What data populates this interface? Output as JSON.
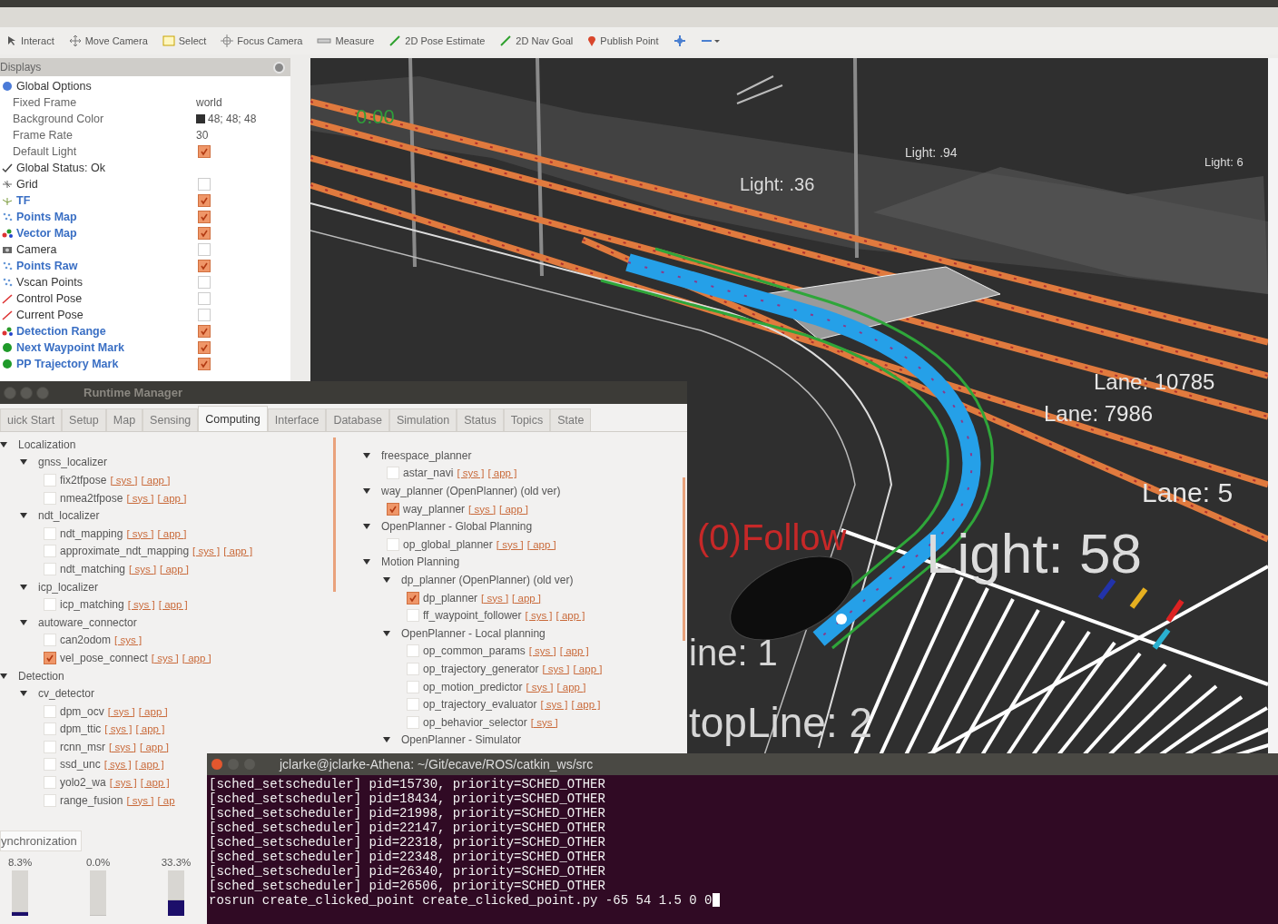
{
  "toolbar": {
    "tools": [
      {
        "label": "Interact",
        "kind": "interact"
      },
      {
        "label": "Move Camera",
        "kind": "move"
      },
      {
        "label": "Select",
        "kind": "select"
      },
      {
        "label": "Focus Camera",
        "kind": "focus"
      },
      {
        "label": "Measure",
        "kind": "measure"
      },
      {
        "label": "2D Pose Estimate",
        "kind": "pose"
      },
      {
        "label": "2D Nav Goal",
        "kind": "pose"
      },
      {
        "label": "Publish Point",
        "kind": "pin"
      },
      {
        "kind": "cross"
      },
      {
        "kind": "minus"
      }
    ]
  },
  "displays": {
    "title": "Displays",
    "items": [
      {
        "label": "Global Options",
        "kind": "globe",
        "highlighted": false,
        "children": [
          {
            "label": "Fixed Frame",
            "value": "world"
          },
          {
            "label": "Background Color",
            "value": "48; 48; 48",
            "kind": "swatch"
          },
          {
            "label": "Frame Rate",
            "value": "30"
          },
          {
            "label": "Default Light",
            "checked": true
          }
        ]
      },
      {
        "label": "Global Status: Ok",
        "kind": "status",
        "highlighted": false
      },
      {
        "label": "Grid",
        "kind": "grid",
        "checked": false,
        "highlighted": false
      },
      {
        "label": "TF",
        "kind": "tf",
        "checked": true,
        "highlighted": true
      },
      {
        "label": "Points Map",
        "kind": "points",
        "checked": true,
        "highlighted": true
      },
      {
        "label": "Vector Map",
        "kind": "markers",
        "checked": true,
        "highlighted": true
      },
      {
        "label": "Camera",
        "kind": "camera",
        "checked": false,
        "highlighted": false
      },
      {
        "label": "Points Raw",
        "kind": "points",
        "checked": true,
        "highlighted": true
      },
      {
        "label": "Vscan Points",
        "kind": "points",
        "checked": false,
        "highlighted": false
      },
      {
        "label": "Control Pose",
        "kind": "pose",
        "checked": false,
        "highlighted": false
      },
      {
        "label": "Current Pose",
        "kind": "pose",
        "checked": false,
        "highlighted": false
      },
      {
        "label": "Detection Range",
        "kind": "markers",
        "checked": true,
        "highlighted": true
      },
      {
        "label": "Next Waypoint Mark",
        "kind": "sphere",
        "checked": true,
        "highlighted": true
      },
      {
        "label": "PP Trajectory Mark",
        "kind": "sphere",
        "checked": true,
        "highlighted": true
      }
    ]
  },
  "scene": {
    "labels": [
      {
        "text": "0.00",
        "kind": "speed"
      },
      {
        "text": "Light: .36",
        "kind": "light"
      },
      {
        "text": "Light: .94",
        "kind": "light"
      },
      {
        "text": "Light: 6",
        "kind": "light"
      },
      {
        "text": "Lane: 10785",
        "kind": "lane"
      },
      {
        "text": "Lane: 7986",
        "kind": "lane"
      },
      {
        "text": "Lane: 5",
        "kind": "lane"
      },
      {
        "text": "(0)Follow",
        "kind": "behavior"
      },
      {
        "text": "Light:  58",
        "kind": "light"
      },
      {
        "text": "ine:  1",
        "kind": "line"
      },
      {
        "text": "topLine:  2",
        "kind": "line"
      }
    ]
  },
  "runtime_manager": {
    "title": "Runtime Manager",
    "tabs": [
      {
        "label": "uick Start",
        "selected": false
      },
      {
        "label": "Setup",
        "selected": false
      },
      {
        "label": "Map",
        "selected": false
      },
      {
        "label": "Sensing",
        "selected": false
      },
      {
        "label": "Computing",
        "selected": true
      },
      {
        "label": "Interface",
        "selected": false
      },
      {
        "label": "Database",
        "selected": false
      },
      {
        "label": "Simulation",
        "selected": false
      },
      {
        "label": "Status",
        "selected": false
      },
      {
        "label": "Topics",
        "selected": false
      },
      {
        "label": "State",
        "selected": false
      }
    ],
    "left_tree": [
      {
        "label": "Localization",
        "expanded": true,
        "children": [
          {
            "label": "gnss_localizer",
            "expanded": true,
            "children": [
              {
                "label": "fix2tfpose",
                "checked": false,
                "links": [
                  "[ sys ]",
                  "[ app ]"
                ]
              },
              {
                "label": "nmea2tfpose",
                "checked": false,
                "links": [
                  "[ sys ]",
                  "[ app ]"
                ]
              }
            ]
          },
          {
            "label": "ndt_localizer",
            "expanded": true,
            "children": [
              {
                "label": "ndt_mapping",
                "checked": false,
                "links": [
                  "[ sys ]",
                  "[ app ]"
                ]
              },
              {
                "label": "approximate_ndt_mapping",
                "checked": false,
                "links": [
                  "[ sys ]",
                  "[ app ]"
                ]
              },
              {
                "label": "ndt_matching",
                "checked": false,
                "links": [
                  "[ sys ]",
                  "[ app ]"
                ]
              }
            ]
          },
          {
            "label": "icp_localizer",
            "expanded": true,
            "children": [
              {
                "label": "icp_matching",
                "checked": false,
                "links": [
                  "[ sys ]",
                  "[ app ]"
                ]
              }
            ]
          },
          {
            "label": "autoware_connector",
            "expanded": true,
            "children": [
              {
                "label": "can2odom",
                "checked": false,
                "links": [
                  "[ sys ]"
                ]
              },
              {
                "label": "vel_pose_connect",
                "checked": true,
                "links": [
                  "[ sys ]",
                  "[ app ]"
                ]
              }
            ]
          }
        ]
      },
      {
        "label": "Detection",
        "expanded": true,
        "children": [
          {
            "label": "cv_detector",
            "expanded": true,
            "children": [
              {
                "label": "dpm_ocv",
                "checked": false,
                "links": [
                  "[ sys ]",
                  "[ app ]"
                ]
              },
              {
                "label": "dpm_ttic",
                "checked": false,
                "links": [
                  "[ sys ]",
                  "[ app ]"
                ]
              },
              {
                "label": "rcnn_msr",
                "checked": false,
                "links": [
                  "[ sys ]",
                  "[ app ]"
                ]
              },
              {
                "label": "ssd_unc",
                "checked": false,
                "links": [
                  "[ sys ]",
                  "[ app ]"
                ]
              },
              {
                "label": "yolo2_wa",
                "checked": false,
                "links": [
                  "[ sys ]",
                  "[ app ]"
                ]
              },
              {
                "label": "range_fusion",
                "checked": false,
                "links": [
                  "[ sys ]",
                  "[ ap"
                ]
              }
            ]
          }
        ]
      }
    ],
    "right_tree": [
      {
        "label": "freespace_planner",
        "expanded": true,
        "children": [
          {
            "label": "astar_navi",
            "checked": false,
            "links": [
              "[ sys ]",
              "[ app ]"
            ]
          }
        ]
      },
      {
        "label": "way_planner (OpenPlanner) (old ver)",
        "expanded": true,
        "children": [
          {
            "label": "way_planner",
            "checked": true,
            "links": [
              "[ sys ]",
              "[ app ]"
            ]
          }
        ]
      },
      {
        "label": "OpenPlanner - Global Planning",
        "expanded": true,
        "children": [
          {
            "label": "op_global_planner",
            "checked": false,
            "links": [
              "[ sys ]",
              "[ app ]"
            ]
          }
        ]
      },
      {
        "label": "Motion Planning",
        "expanded": true,
        "children": [
          {
            "label": "dp_planner (OpenPlanner) (old ver)",
            "expanded": true,
            "children": [
              {
                "label": "dp_planner",
                "checked": true,
                "links": [
                  "[ sys ]",
                  "[ app ]"
                ]
              },
              {
                "label": "ff_waypoint_follower",
                "checked": false,
                "links": [
                  "[ sys ]",
                  "[ app ]"
                ]
              }
            ]
          },
          {
            "label": "OpenPlanner - Local planning",
            "expanded": true,
            "children": [
              {
                "label": "op_common_params",
                "checked": false,
                "links": [
                  "[ sys ]",
                  "[ app ]"
                ]
              },
              {
                "label": "op_trajectory_generator",
                "checked": false,
                "links": [
                  "[ sys ]",
                  "[ app ]"
                ]
              },
              {
                "label": "op_motion_predictor",
                "checked": false,
                "links": [
                  "[ sys ]",
                  "[ app ]"
                ]
              },
              {
                "label": "op_trajectory_evaluator",
                "checked": false,
                "links": [
                  "[ sys ]",
                  "[ app ]"
                ]
              },
              {
                "label": "op_behavior_selector",
                "checked": false,
                "links": [
                  "[ sys ]"
                ]
              }
            ]
          },
          {
            "label": "OpenPlanner - Simulator",
            "expanded": true
          }
        ]
      }
    ],
    "sync_tab": "ynchronization",
    "meters": [
      {
        "label": "8.3%",
        "level": 0.083
      },
      {
        "label": "0.0%",
        "level": 0
      },
      {
        "label": "33.3%",
        "level": 0.333
      }
    ]
  },
  "terminal": {
    "title": "jclarke@jclarke-Athena: ~/Git/ecave/ROS/catkin_ws/src",
    "lines": [
      "[sched_setscheduler] pid=15730, priority=SCHED_OTHER",
      "[sched_setscheduler] pid=18434, priority=SCHED_OTHER",
      "[sched_setscheduler] pid=21998, priority=SCHED_OTHER",
      "[sched_setscheduler] pid=22147, priority=SCHED_OTHER",
      "[sched_setscheduler] pid=22318, priority=SCHED_OTHER",
      "[sched_setscheduler] pid=22348, priority=SCHED_OTHER",
      "[sched_setscheduler] pid=26340, priority=SCHED_OTHER",
      "[sched_setscheduler] pid=26506, priority=SCHED_OTHER"
    ],
    "prompt": "rosrun create_clicked_point create_clicked_point.py -65 54 1.5 0 0"
  }
}
